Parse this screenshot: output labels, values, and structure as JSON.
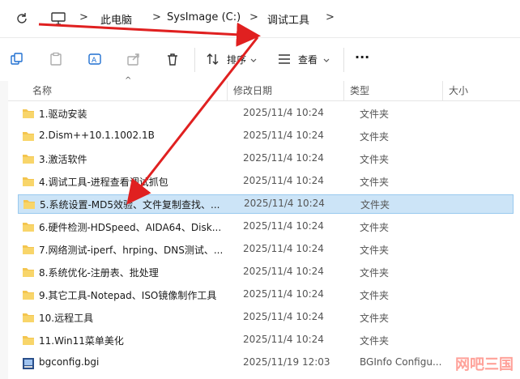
{
  "address": {
    "crumbs": [
      "此电脑",
      "SysImage (C:)",
      "调试工具"
    ],
    "separator": ">"
  },
  "toolbar": {
    "sort_label": "排序",
    "view_label": "查看",
    "more_label": "···"
  },
  "columns": {
    "name": "名称",
    "modified": "修改日期",
    "type": "类型",
    "size": "大小"
  },
  "files": [
    {
      "name": "1.驱动安装",
      "date": "2025/11/4 10:24",
      "type": "文件夹",
      "icon": "folder-icon"
    },
    {
      "name": "2.Dism++10.1.1002.1B",
      "date": "2025/11/4 10:24",
      "type": "文件夹",
      "icon": "folder-icon"
    },
    {
      "name": "3.激活软件",
      "date": "2025/11/4 10:24",
      "type": "文件夹",
      "icon": "folder-icon"
    },
    {
      "name": "4.调试工具-进程查看调试抓包",
      "date": "2025/11/4 10:24",
      "type": "文件夹",
      "icon": "folder-icon"
    },
    {
      "name": "5.系统设置-MD5效验、文件复制查找、...",
      "date": "2025/11/4 10:24",
      "type": "文件夹",
      "icon": "folder-icon"
    },
    {
      "name": "6.硬件检测-HDSpeed、AIDA64、Disk...",
      "date": "2025/11/4 10:24",
      "type": "文件夹",
      "icon": "folder-icon"
    },
    {
      "name": "7.网络测试-iperf、hrping、DNS测试、...",
      "date": "2025/11/4 10:24",
      "type": "文件夹",
      "icon": "folder-icon"
    },
    {
      "name": "8.系统优化-注册表、批处理",
      "date": "2025/11/4 10:24",
      "type": "文件夹",
      "icon": "folder-icon"
    },
    {
      "name": "9.其它工具-Notepad、ISO镜像制作工具",
      "date": "2025/11/4 10:24",
      "type": "文件夹",
      "icon": "folder-icon"
    },
    {
      "name": "10.远程工具",
      "date": "2025/11/4 10:24",
      "type": "文件夹",
      "icon": "folder-icon"
    },
    {
      "name": "11.Win11菜单美化",
      "date": "2025/11/4 10:24",
      "type": "文件夹",
      "icon": "folder-icon"
    },
    {
      "name": "bgconfig.bgi",
      "date": "2025/11/19 12:03",
      "type": "BGInfo Configu...",
      "icon": "bgi-file-icon"
    }
  ],
  "selected_index": 4,
  "colors": {
    "folder": "#f4c54f",
    "selection": "#cce4f7",
    "annotation_arrow": "#e02020"
  }
}
